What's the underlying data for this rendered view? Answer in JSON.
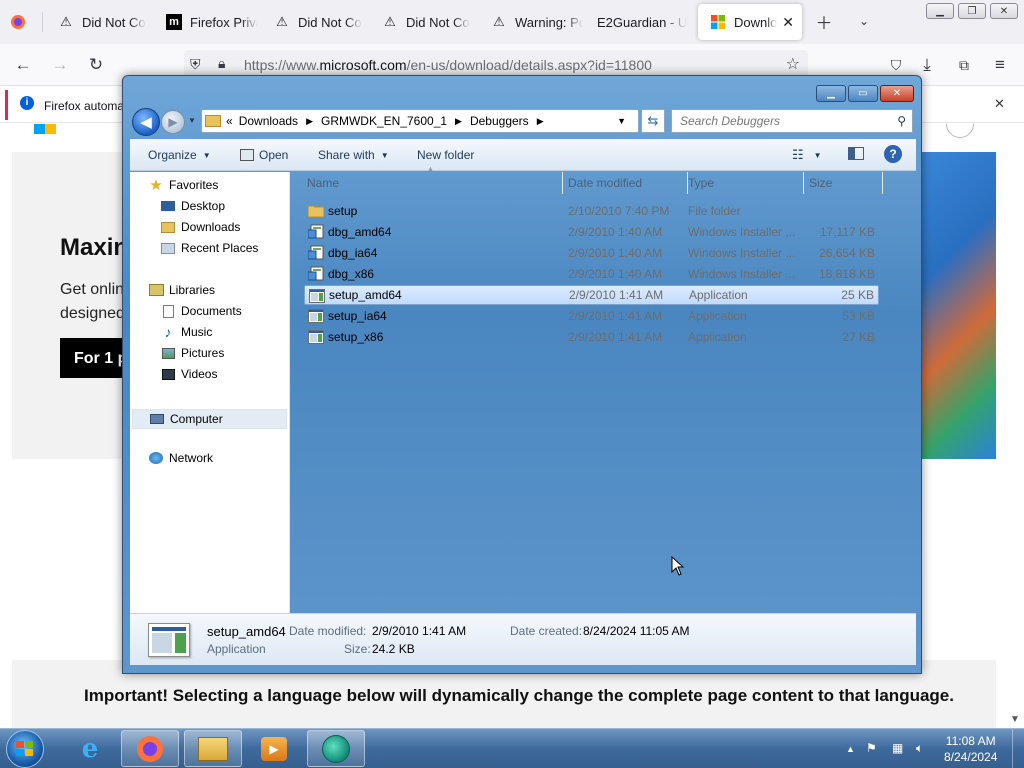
{
  "browser": {
    "tabs": [
      {
        "label": "Did Not Co",
        "icon": "warning-icon"
      },
      {
        "label": "Firefox Priva",
        "icon": "m-logo-icon"
      },
      {
        "label": "Did Not Co",
        "icon": "warning-icon"
      },
      {
        "label": "Did Not Co",
        "icon": "warning-icon"
      },
      {
        "label": "Warning: Po",
        "icon": "warning-icon"
      },
      {
        "label": "E2Guardian - U",
        "icon": ""
      },
      {
        "label": "Downlo",
        "icon": "microsoft-logo-icon"
      }
    ],
    "url_prefix": "https://www.",
    "url_domain": "microsoft.com",
    "url_path": "/en-us/download/details.aspx?id=11800",
    "notification": "Firefox automa"
  },
  "page": {
    "heading": "Maxin",
    "para_line1": "Get onlin",
    "para_line2": "designed",
    "button": "For 1 p",
    "important": "Important! Selecting a language below will dynamically change the complete page content to that language."
  },
  "explorer": {
    "breadcrumb": [
      "Downloads",
      "GRMWDK_EN_7600_1",
      "Debuggers"
    ],
    "search_placeholder": "Search Debuggers",
    "toolbar": {
      "organize": "Organize",
      "open": "Open",
      "share_with": "Share with",
      "new_folder": "New folder"
    },
    "nav": {
      "favorites": "Favorites",
      "desktop": "Desktop",
      "downloads": "Downloads",
      "recent_places": "Recent Places",
      "libraries": "Libraries",
      "documents": "Documents",
      "music": "Music",
      "pictures": "Pictures",
      "videos": "Videos",
      "computer": "Computer",
      "network": "Network"
    },
    "columns": {
      "name": "Name",
      "date": "Date modified",
      "type": "Type",
      "size": "Size"
    },
    "files": [
      {
        "name": "setup",
        "date": "2/10/2010 7:40 PM",
        "type": "File folder",
        "size": "",
        "icon": "folder-icon"
      },
      {
        "name": "dbg_amd64",
        "date": "2/9/2010 1:40 AM",
        "type": "Windows Installer ...",
        "size": "17,117 KB",
        "icon": "installer-icon"
      },
      {
        "name": "dbg_ia64",
        "date": "2/9/2010 1:40 AM",
        "type": "Windows Installer ...",
        "size": "26,654 KB",
        "icon": "installer-icon"
      },
      {
        "name": "dbg_x86",
        "date": "2/9/2010 1:40 AM",
        "type": "Windows Installer ...",
        "size": "18,818 KB",
        "icon": "installer-icon"
      },
      {
        "name": "setup_amd64",
        "date": "2/9/2010 1:41 AM",
        "type": "Application",
        "size": "25 KB",
        "icon": "application-icon"
      },
      {
        "name": "setup_ia64",
        "date": "2/9/2010 1:41 AM",
        "type": "Application",
        "size": "53 KB",
        "icon": "application-icon"
      },
      {
        "name": "setup_x86",
        "date": "2/9/2010 1:41 AM",
        "type": "Application",
        "size": "27 KB",
        "icon": "application-icon"
      }
    ],
    "selected_index": 4,
    "details": {
      "name": "setup_amd64",
      "type": "Application",
      "date_modified_label": "Date modified:",
      "date_modified": "2/9/2010 1:41 AM",
      "date_created_label": "Date created:",
      "date_created": "8/24/2024 11:05 AM",
      "size_label": "Size:",
      "size": "24.2 KB"
    }
  },
  "taskbar": {
    "time": "11:08 AM",
    "date": "8/24/2024"
  },
  "colors": {
    "selection": "#c1dbfc",
    "taskbar": "#3e6a9c",
    "explorer_frame": "#4a86c0"
  }
}
